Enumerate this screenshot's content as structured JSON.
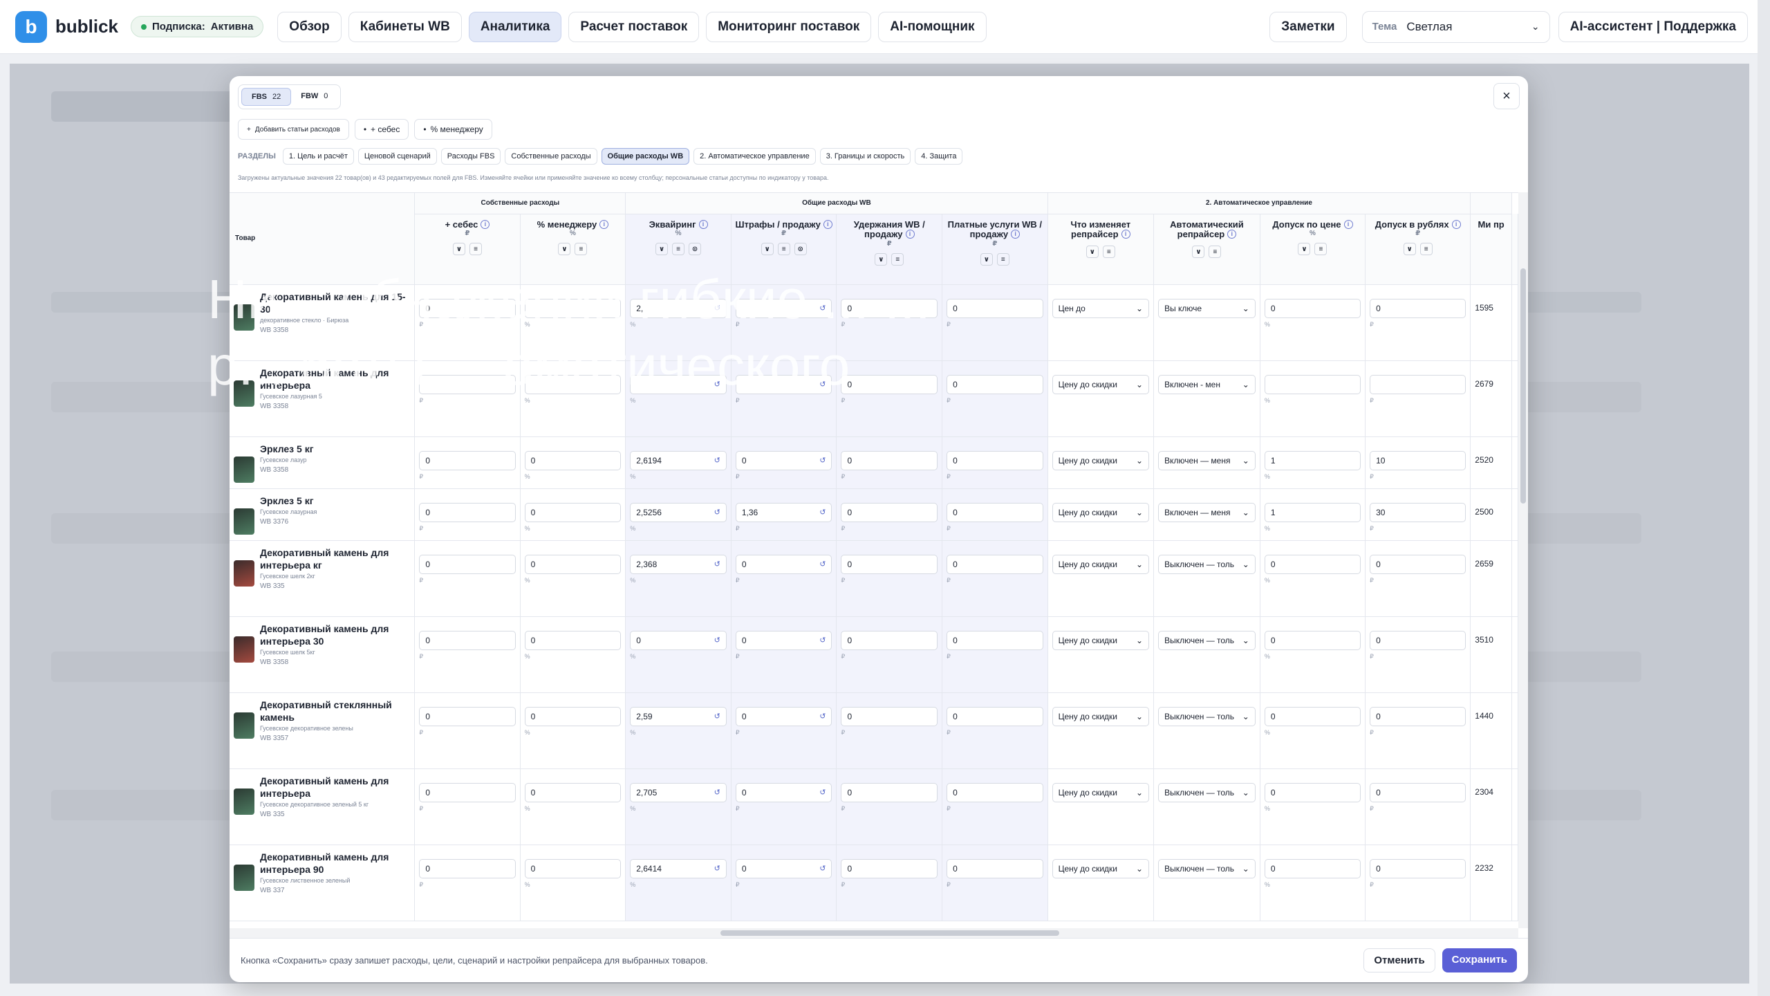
{
  "app": {
    "logo": "b",
    "brand": "bublick",
    "subscription_label": "Подписка:",
    "subscription_status": "Активна"
  },
  "nav": [
    "Обзор",
    "Кабинеты WB",
    "Аналитика",
    "Расчет поставок",
    "Мониторинг поставок",
    "AI-помощник"
  ],
  "active_nav": "Аналитика",
  "top_right": {
    "notes": "Заметки",
    "theme_label": "Тема",
    "theme_value": "Светлая",
    "support": "AI-ассистент | Поддержка"
  },
  "modal": {
    "tabs": [
      {
        "label": "FBS",
        "count": "22"
      },
      {
        "label": "FBW",
        "count": "0"
      }
    ],
    "close": "×",
    "actions": [
      "Добавить статьи расходов",
      "+ себес",
      "% менеджеру"
    ],
    "sections_title": "РАЗДЕЛЫ",
    "sections": [
      "1. Цель и расчёт",
      "Ценовой сценарий",
      "Расходы FBS",
      "Собственные расходы",
      "Общие расходы WB",
      "2. Автоматическое управление",
      "3. Границы и скорость",
      "4. Защита"
    ],
    "active_section": "Общие расходы WB",
    "hint": "Загружены актуальные значения 22 товар(ов) и 43 редактируемых полей для FBS. Изменяйте ячейки или применяйте значение ко всему столбцу; персональные статьи доступны по индикатору у товара.",
    "groups": {
      "own": "Собственные расходы",
      "wb": "Общие расходы WB",
      "auto": "2. Автоматическое управление"
    },
    "product_header": "Товар",
    "columns": [
      {
        "name": "+ себес",
        "unit": "₽"
      },
      {
        "name": "% менеджеру",
        "unit": "%"
      },
      {
        "name": "Эквайринг",
        "unit": "%"
      },
      {
        "name": "Штрафы / продажу",
        "unit": "₽"
      },
      {
        "name": "Удержания WB / продажу",
        "unit": "₽"
      },
      {
        "name": "Платные услуги WB / продажу",
        "unit": "₽"
      },
      {
        "name": "Что изменяет репрайсер",
        "unit": ""
      },
      {
        "name": "Автоматический репрайсер",
        "unit": ""
      },
      {
        "name": "Допуск по цене",
        "unit": "%"
      },
      {
        "name": "Допуск в рублях",
        "unit": "₽"
      },
      {
        "name": "Ми пр",
        "unit": ""
      }
    ],
    "rows": [
      {
        "name": "Декоративный камень для 15-30",
        "cat": "декоративное стекло · Бирюза",
        "wb": "WB 3358",
        "thumb": "green",
        "sebes": "0",
        "manager": "",
        "acq": "2,",
        "fines": "",
        "hold": "0",
        "paid": "0",
        "changes": "Цен до",
        "auto": "Вы ключе",
        "tol_pct": "0",
        "tol_rub": "0",
        "min": "1595"
      },
      {
        "name": "Декоративный камень для интерьера",
        "cat": "Гусевское лазурная 5",
        "wb": "WB 3358",
        "thumb": "green",
        "sebes": "",
        "manager": "",
        "acq": "",
        "fines": "",
        "hold": "0",
        "paid": "0",
        "changes": "Цену до скидки",
        "auto": "Включен - мен",
        "tol_pct": "",
        "tol_rub": "",
        "min": "2679"
      },
      {
        "name": "Эрклез 5 кг",
        "cat": "Гусевское лазур",
        "wb": "WB 3358",
        "thumb": "green",
        "sebes": "0",
        "manager": "0",
        "acq": "2,6194",
        "fines": "0",
        "hold": "0",
        "paid": "0",
        "changes": "Цену до скидки",
        "auto": "Включен — меня",
        "tol_pct": "1",
        "tol_rub": "10",
        "min": "2520"
      },
      {
        "name": "Эрклез 5 кг",
        "cat": "Гусевское лазурная",
        "wb": "WB 3376",
        "thumb": "green",
        "sebes": "0",
        "manager": "0",
        "acq": "2,5256",
        "fines": "1,36",
        "hold": "0",
        "paid": "0",
        "changes": "Цену до скидки",
        "auto": "Включен — меня",
        "tol_pct": "1",
        "tol_rub": "30",
        "min": "2500"
      },
      {
        "name": "Декоративный камень для интерьера кг",
        "cat": "Гусевское шелк 2кг",
        "wb": "WB 335",
        "thumb": "red",
        "sebes": "0",
        "manager": "0",
        "acq": "2,368",
        "fines": "0",
        "hold": "0",
        "paid": "0",
        "changes": "Цену до скидки",
        "auto": "Выключен — толь",
        "tol_pct": "0",
        "tol_rub": "0",
        "min": "2659"
      },
      {
        "name": "Декоративный камень для интерьера 30",
        "cat": "Гусевское шелк 5кг",
        "wb": "WB 3358",
        "thumb": "red",
        "sebes": "0",
        "manager": "0",
        "acq": "0",
        "fines": "0",
        "hold": "0",
        "paid": "0",
        "changes": "Цену до скидки",
        "auto": "Выключен — толь",
        "tol_pct": "0",
        "tol_rub": "0",
        "min": "3510"
      },
      {
        "name": "Декоративный стеклянный камень",
        "cat": "Гусевское декоративное зелены",
        "wb": "WB 3357",
        "thumb": "green",
        "sebes": "0",
        "manager": "0",
        "acq": "2,59",
        "fines": "0",
        "hold": "0",
        "paid": "0",
        "changes": "Цену до скидки",
        "auto": "Выключен — толь",
        "tol_pct": "0",
        "tol_rub": "0",
        "min": "1440"
      },
      {
        "name": "Декоративный камень для интерьера",
        "cat": "Гусевское декоративное зеленый 5 кг",
        "wb": "WB 335",
        "thumb": "green",
        "sebes": "0",
        "manager": "0",
        "acq": "2,705",
        "fines": "0",
        "hold": "0",
        "paid": "0",
        "changes": "Цену до скидки",
        "auto": "Выключен — толь",
        "tol_pct": "0",
        "tol_rub": "0",
        "min": "2304"
      },
      {
        "name": "Декоративный камень для интерьера 90",
        "cat": "Гусевское лиственное зеленый",
        "wb": "WB 337",
        "thumb": "green",
        "sebes": "0",
        "manager": "0",
        "acq": "2,6414",
        "fines": "0",
        "hold": "0",
        "paid": "0",
        "changes": "Цену до скидки",
        "auto": "Выключен — толь",
        "tol_pct": "0",
        "tol_rub": "0",
        "min": "2232"
      }
    ],
    "footer_text": "Кнопка «Сохранить» сразу запишет расходы, цели, сценарий и настройки репрайсера для выбранных товаров.",
    "cancel": "Отменить",
    "save": "Сохранить"
  },
  "overlay_text": {
    "line1": "Ни... обнажении гибкие ... ...",
    "line2": "р... боты ... оматического ..."
  }
}
